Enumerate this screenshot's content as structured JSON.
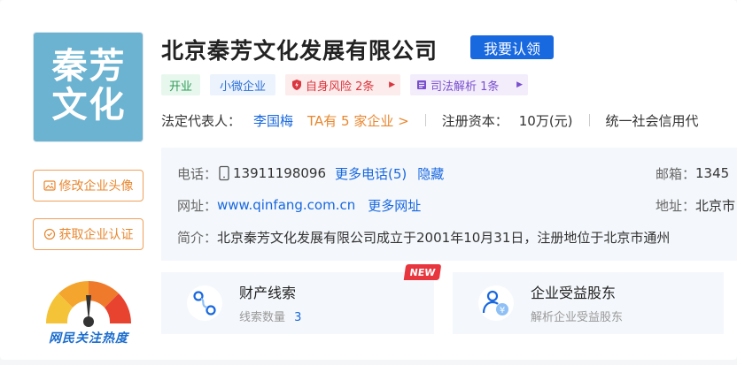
{
  "logo": {
    "line1": "秦芳",
    "line2": "文化"
  },
  "company": {
    "name": "北京秦芳文化发展有限公司",
    "claim_label": "我要认领"
  },
  "tags": {
    "status": "开业",
    "scale": "小微企业",
    "risk": "自身风险 2条",
    "judicial": "司法解析 1条"
  },
  "legal": {
    "rep_label": "法定代表人：",
    "rep_name": "李国梅",
    "ta_link": "TA有 5 家企业 >",
    "capital_label": "注册资本：",
    "capital_value": "10万(元)",
    "credit_label": "统一社会信用代"
  },
  "contact": {
    "phone_label": "电话：",
    "phone_value": "13911198096",
    "more_phone": "更多电话(5)",
    "hide": "隐藏",
    "email_label": "邮箱：",
    "email_value": "1345",
    "website_label": "网址：",
    "website_value": "www.qinfang.com.cn",
    "more_website": "更多网址",
    "address_label": "地址：",
    "address_value": "北京市",
    "intro_label": "简介：",
    "intro_value": "北京秦芳文化发展有限公司成立于2001年10月31日，注册地位于北京市通州"
  },
  "side": {
    "edit_avatar": "修改企业头像",
    "get_cert": "获取企业认证",
    "heat_label": "网民关注热度"
  },
  "cards": {
    "property": {
      "title": "财产线索",
      "sub_label": "线索数量",
      "count": "3",
      "badge": "NEW"
    },
    "beneficiary": {
      "title": "企业受益股东",
      "sub": "解析企业受益股东"
    }
  },
  "colors": {
    "brand_blue": "#1868e0",
    "accent_orange": "#e8872f",
    "logo_bg": "#6bb3d1"
  }
}
